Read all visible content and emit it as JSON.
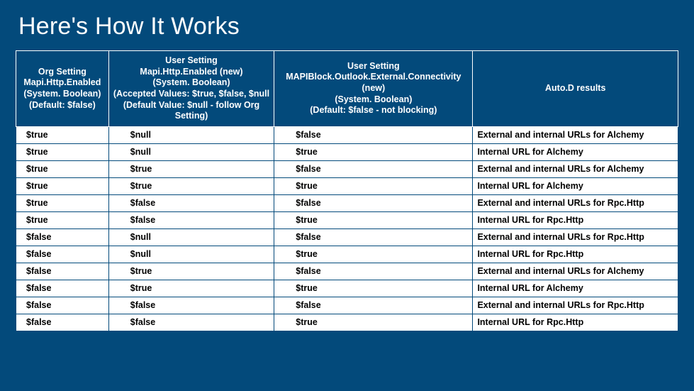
{
  "title": "Here's How It Works",
  "headers": [
    "Org Setting\nMapi.Http.Enabled\n(System. Boolean)\n(Default: $false)",
    "User Setting\nMapi.Http.Enabled (new)\n(System. Boolean)\n(Accepted Values: $true, $false, $null\n(Default Value: $null - follow Org Setting)",
    "User Setting\nMAPIBlock.Outlook.External.Connectivity (new)\n(System. Boolean)\n(Default: $false - not blocking)",
    "Auto.D results"
  ],
  "rows": [
    [
      "$true",
      "$null",
      "$false",
      "External and internal URLs for Alchemy"
    ],
    [
      "$true",
      "$null",
      "$true",
      "Internal URL for Alchemy"
    ],
    [
      "$true",
      "$true",
      "$false",
      "External and internal URLs for Alchemy"
    ],
    [
      "$true",
      "$true",
      "$true",
      "Internal URL for Alchemy"
    ],
    [
      "$true",
      "$false",
      "$false",
      "External and internal URLs for Rpc.Http"
    ],
    [
      "$true",
      "$false",
      "$true",
      "Internal URL for Rpc.Http"
    ],
    [
      "$false",
      "$null",
      "$false",
      "External and internal URLs for Rpc.Http"
    ],
    [
      "$false",
      "$null",
      "$true",
      "Internal URL for Rpc.Http"
    ],
    [
      "$false",
      "$true",
      "$false",
      "External and internal URLs for Alchemy"
    ],
    [
      "$false",
      "$true",
      "$true",
      "Internal URL for Alchemy"
    ],
    [
      "$false",
      "$false",
      "$false",
      "External and internal URLs for Rpc.Http"
    ],
    [
      "$false",
      "$false",
      "$true",
      "Internal URL for Rpc.Http"
    ]
  ]
}
